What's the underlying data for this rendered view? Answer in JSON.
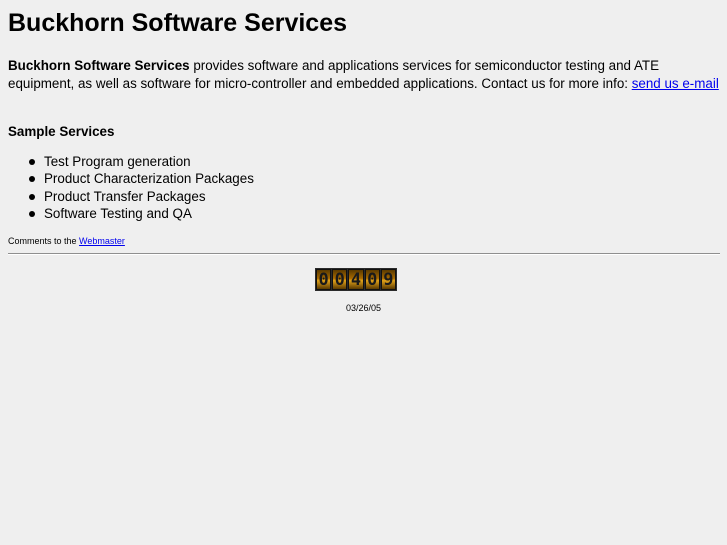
{
  "title": "Buckhorn Software Services",
  "intro": {
    "company": "Buckhorn Software Services",
    "text": " provides software and applications services for semiconductor testing and ATE equipment, as well as software for micro-controller and embedded applications. Contact us for more info: ",
    "link_label": "send us e-mail"
  },
  "services": {
    "heading": "Sample Services",
    "items": [
      "Test Program generation",
      "Product Characterization Packages",
      "Product Transfer Packages",
      "Software Testing and QA"
    ]
  },
  "comments": {
    "prefix": "Comments to the ",
    "link_label": "Webmaster"
  },
  "counter": {
    "value": "00409",
    "digits": [
      "0",
      "0",
      "4",
      "0",
      "9"
    ]
  },
  "date": "03/26/05",
  "colors": {
    "background": "#efefef",
    "link": "#0000ee"
  }
}
